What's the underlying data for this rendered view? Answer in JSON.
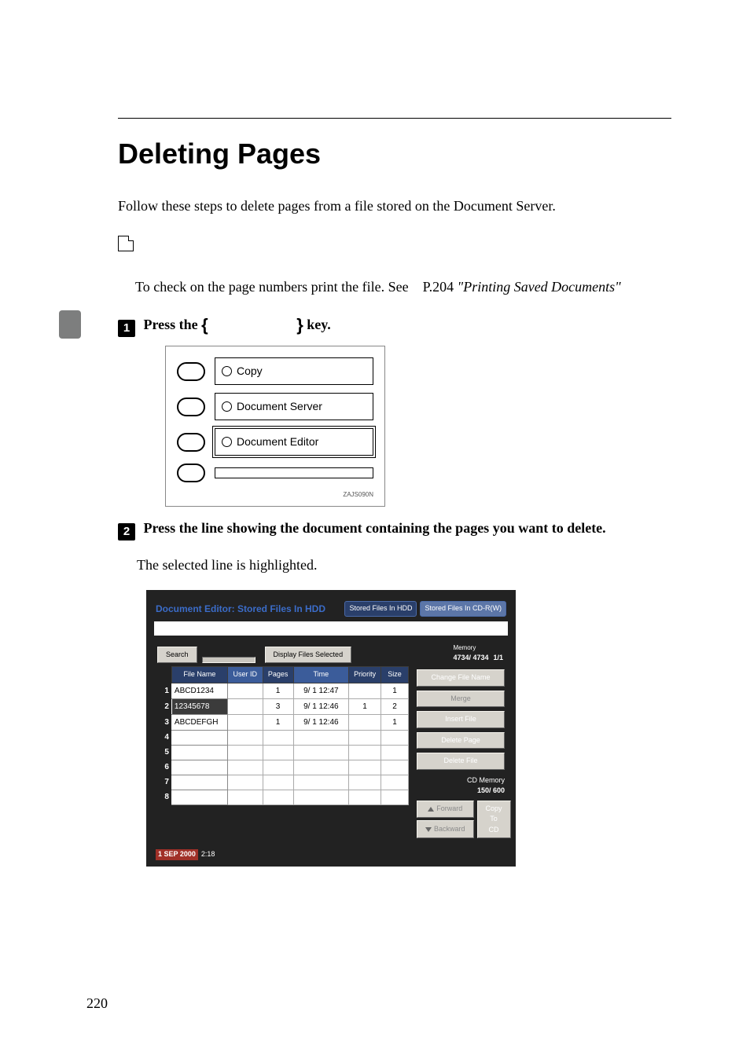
{
  "page_number": "220",
  "heading": "Deleting Pages",
  "intro": "Follow these steps to delete pages from a file stored on the Document Server.",
  "note": {
    "prefix": "To check on the page numbers print the file. See",
    "ref_page": "P.204",
    "ref_title": "\"Printing Saved Documents\""
  },
  "step1": {
    "text_before": "Press the ",
    "key_name": "",
    "text_after": " key."
  },
  "panel1": {
    "items": [
      "Copy",
      "Document Server",
      "Document Editor",
      ""
    ],
    "code": "ZAJS090N"
  },
  "step2": {
    "title": "Press the line showing the document containing the pages you want to delete.",
    "result": "The selected line is highlighted."
  },
  "screen": {
    "title": "Document Editor: Stored Files In HDD",
    "tabs": {
      "hdd": "Stored Files In HDD",
      "cd": "Stored Files In CD-R(W)"
    },
    "toolbar": {
      "search": "Search",
      "display": "Display Files Selected",
      "memory_label": "Memory",
      "memory_value": "4734/   4734",
      "page_counter": "1/1"
    },
    "columns": [
      "File Name",
      "User ID",
      "Pages",
      "Time",
      "Priority",
      "Size"
    ],
    "rows": [
      {
        "n": "1",
        "name": "ABCD1234",
        "user": "",
        "pages": "1",
        "time": "9/ 1 12:47",
        "priority": "",
        "size": "1",
        "selected": false
      },
      {
        "n": "2",
        "name": "12345678",
        "user": "",
        "pages": "3",
        "time": "9/ 1 12:46",
        "priority": "1",
        "size": "2",
        "selected": true
      },
      {
        "n": "3",
        "name": "ABCDEFGH",
        "user": "",
        "pages": "1",
        "time": "9/ 1 12:46",
        "priority": "",
        "size": "1",
        "selected": false
      },
      {
        "n": "4",
        "name": "",
        "user": "",
        "pages": "",
        "time": "",
        "priority": "",
        "size": "",
        "selected": false
      },
      {
        "n": "5",
        "name": "",
        "user": "",
        "pages": "",
        "time": "",
        "priority": "",
        "size": "",
        "selected": false
      },
      {
        "n": "6",
        "name": "",
        "user": "",
        "pages": "",
        "time": "",
        "priority": "",
        "size": "",
        "selected": false
      },
      {
        "n": "7",
        "name": "",
        "user": "",
        "pages": "",
        "time": "",
        "priority": "",
        "size": "",
        "selected": false
      },
      {
        "n": "8",
        "name": "",
        "user": "",
        "pages": "",
        "time": "",
        "priority": "",
        "size": "",
        "selected": false
      }
    ],
    "ops": {
      "change_name": "Change File Name",
      "merge": "Merge",
      "insert_file": "Insert File",
      "delete_page": "Delete Page",
      "delete_file": "Delete File",
      "cd_memory_label": "CD Memory",
      "cd_memory_value": "150/    600",
      "forward": "Forward",
      "backward": "Backward",
      "copy_to_cd": "Copy To CD"
    },
    "status_date": "1 SEP 2000",
    "status_time": "2:18"
  }
}
